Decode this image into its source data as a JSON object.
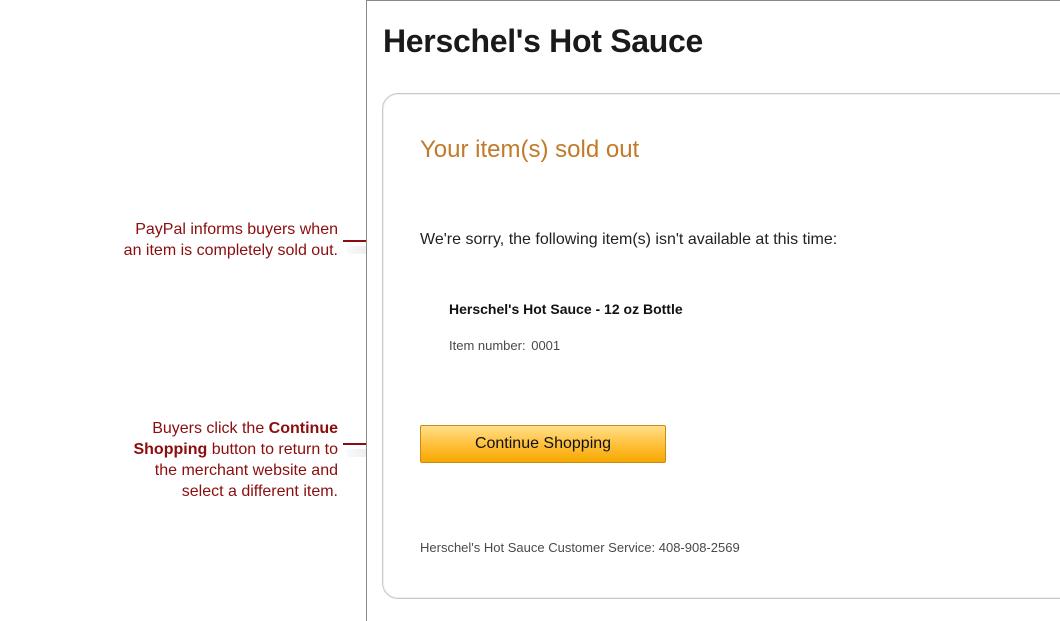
{
  "merchant": {
    "title": "Herschel's Hot Sauce"
  },
  "message": {
    "heading": "Your item(s) sold out",
    "body": "We're sorry, the following item(s) isn't available at this time:"
  },
  "item": {
    "name": "Herschel's Hot Sauce - 12 oz Bottle",
    "number_label": "Item number:",
    "number_value": "0001"
  },
  "continue_button": {
    "label": "Continue Shopping"
  },
  "customer_service": {
    "text": "Herschel's Hot Sauce Customer Service: 408-908-2569"
  },
  "annotations": {
    "sold_out_line1": "PayPal informs buyers when",
    "sold_out_line2": "an item is completely sold out.",
    "button_pre": "Buyers click the ",
    "button_bold1": "Continue",
    "button_bold2": "Shopping",
    "button_post1": " button to return to",
    "button_line3": "the merchant website and",
    "button_line4": "select a different item."
  },
  "colors": {
    "heading_orange": "#c27a2a",
    "annotation_red": "#8b0d0d",
    "button_gold": "#ffc13d"
  }
}
